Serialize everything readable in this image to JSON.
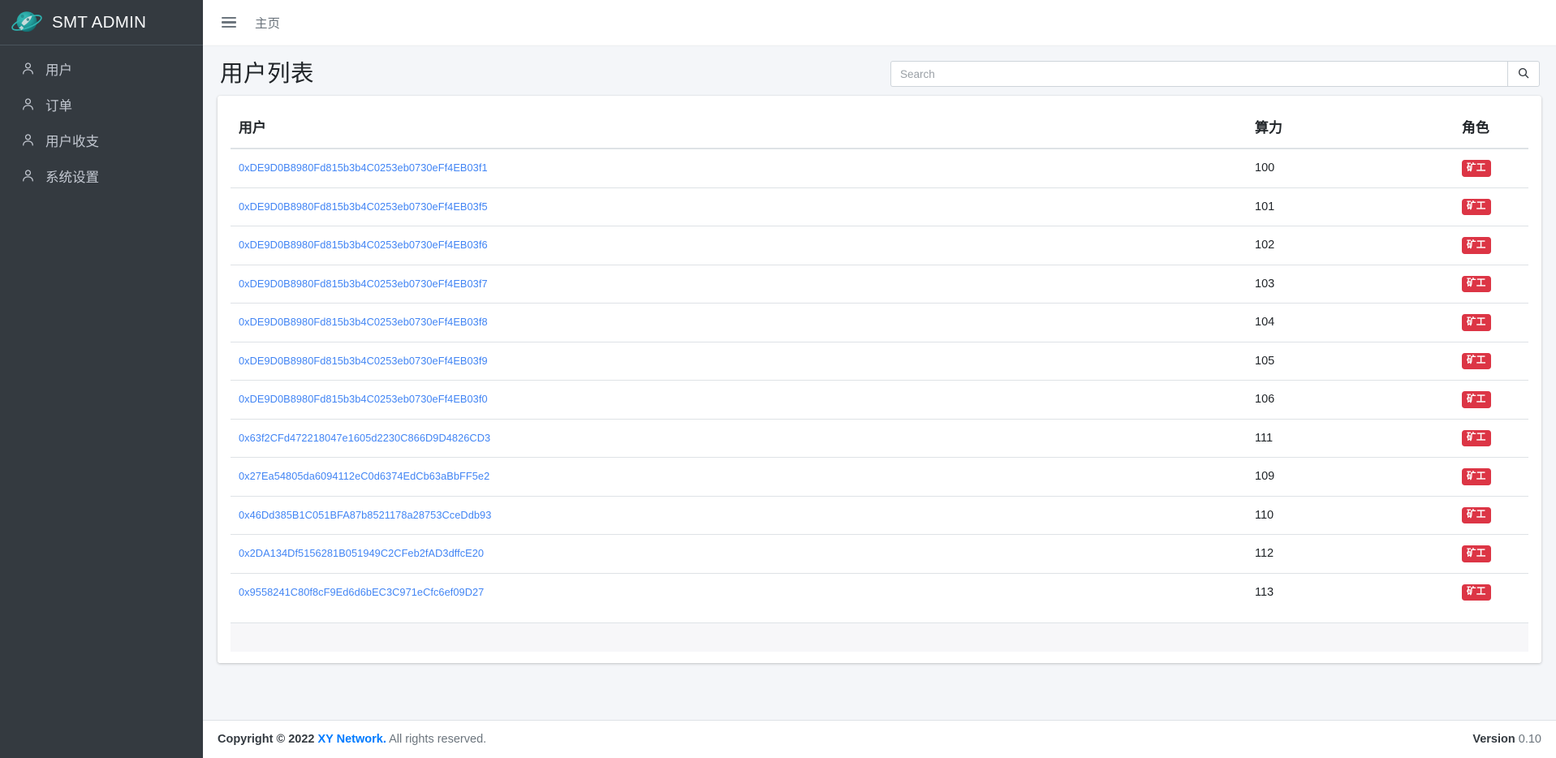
{
  "brand": {
    "title": "SMT ADMIN",
    "logo_icon": "planet-rocket-icon"
  },
  "sidebar": {
    "items": [
      {
        "label": "用户",
        "icon": "user-icon"
      },
      {
        "label": "订单",
        "icon": "user-icon"
      },
      {
        "label": "用户收支",
        "icon": "user-icon"
      },
      {
        "label": "系统设置",
        "icon": "user-icon"
      }
    ]
  },
  "navbar": {
    "menu_toggle_icon": "hamburger-icon",
    "home_label": "主页"
  },
  "content_header": {
    "page_title": "用户列表"
  },
  "search": {
    "value": "",
    "placeholder": "Search",
    "button_icon": "search-icon"
  },
  "table": {
    "columns": [
      "用户",
      "算力",
      "角色"
    ],
    "rows": [
      {
        "user": "0xDE9D0B8980Fd815b3b4C0253eb0730eFf4EB03f1",
        "power": "100",
        "role": "矿工"
      },
      {
        "user": "0xDE9D0B8980Fd815b3b4C0253eb0730eFf4EB03f5",
        "power": "101",
        "role": "矿工"
      },
      {
        "user": "0xDE9D0B8980Fd815b3b4C0253eb0730eFf4EB03f6",
        "power": "102",
        "role": "矿工"
      },
      {
        "user": "0xDE9D0B8980Fd815b3b4C0253eb0730eFf4EB03f7",
        "power": "103",
        "role": "矿工"
      },
      {
        "user": "0xDE9D0B8980Fd815b3b4C0253eb0730eFf4EB03f8",
        "power": "104",
        "role": "矿工"
      },
      {
        "user": "0xDE9D0B8980Fd815b3b4C0253eb0730eFf4EB03f9",
        "power": "105",
        "role": "矿工"
      },
      {
        "user": "0xDE9D0B8980Fd815b3b4C0253eb0730eFf4EB03f0",
        "power": "106",
        "role": "矿工"
      },
      {
        "user": "0x63f2CFd472218047e1605d2230C866D9D4826CD3",
        "power": "111",
        "role": "矿工"
      },
      {
        "user": "0x27Ea54805da6094112eC0d6374EdCb63aBbFF5e2",
        "power": "109",
        "role": "矿工"
      },
      {
        "user": "0x46Dd385B1C051BFA87b8521178a28753CceDdb93",
        "power": "110",
        "role": "矿工"
      },
      {
        "user": "0x2DA134Df5156281B051949C2CFeb2fAD3dffcE20",
        "power": "112",
        "role": "矿工"
      },
      {
        "user": "0x9558241C80f8cF9Ed6d6bEC3C971eCfc6ef09D27",
        "power": "113",
        "role": "矿工"
      }
    ]
  },
  "footer": {
    "copyright_strong": "Copyright © 2022",
    "company_link": "XY Network.",
    "rights_text": "All rights reserved.",
    "version_label": "Version",
    "version_value": "0.10"
  },
  "colors": {
    "sidebar_bg": "#343a40",
    "accent_link": "#007bff",
    "address_link": "#4285f4",
    "badge_danger": "#dc3545",
    "brand_teal": "#1fa8a8",
    "page_bg": "#f4f6f9"
  }
}
